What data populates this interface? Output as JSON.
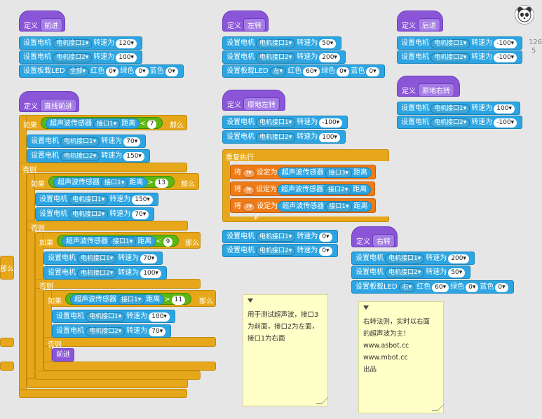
{
  "labels": {
    "define": "定义",
    "set_motor": "设置电机",
    "speed": "转速为",
    "set_led": "设置板载LED",
    "red": "红色",
    "green": "绿色",
    "blue": "蓝色",
    "if": "如果",
    "else": "否则",
    "then": "那么",
    "sensor": "超声波传感器",
    "distance": "距离",
    "repeat": "重复执行",
    "set_var": "将",
    "set_to": "设定为",
    "lt": "<",
    "gt": ">",
    "motor1": "电机接口1▾",
    "motor2": "电机接口2▾"
  },
  "scripts": {
    "forward": {
      "name": "前进",
      "m1": "120▾",
      "m2": "100▾",
      "led_pos": "全部▾",
      "r": "0▾",
      "g": "0▾",
      "b": "0▾"
    },
    "left": {
      "name": "左转",
      "m1": "50▾",
      "m2": "200▾",
      "led_pos": "左▾",
      "r": "60▾",
      "g": "0▾",
      "b": "0▾"
    },
    "back": {
      "name": "后退",
      "m1": "-100▾",
      "m2": "-100▾"
    },
    "spin_right": {
      "name": "原地右转",
      "m1": "100▾",
      "m2": "-100▾"
    },
    "spin_left": {
      "name": "原地左转",
      "m1": "-100▾",
      "m2": "100▾"
    },
    "right": {
      "name": "右转",
      "m1": "200▾",
      "m2": "50▾",
      "led_pos": "右▾",
      "r": "60▾",
      "g": "0▾",
      "b": "0▾"
    },
    "straight": {
      "name": "直线前进",
      "c1_port": "接口1▾",
      "c1_val": "7",
      "a_m1": "70▾",
      "a_m2": "150▾",
      "c2_port": "接口1▾",
      "c2_val": "13",
      "b_m1": "150▾",
      "b_m2": "70▾",
      "c3_port": "接口1▾",
      "c3_val": "9",
      "c_m1": "70▾",
      "c_m2": "100▾",
      "c4_port": "接口1▾",
      "c4_val": "11",
      "d_m1": "100▾",
      "d_m2": "70▾",
      "call": "前进"
    },
    "loop": {
      "v1": "f▾",
      "p1": "接口3▾",
      "v2": "l▾",
      "p2": "接口2▾",
      "v3": "r▾",
      "p3": "接口1▾",
      "s_m1": "0▾",
      "s_m2": "0▾"
    }
  },
  "notes": {
    "note1": [
      "用于测试超声波，接口3",
      "为前面，接口2为左面，",
      "接口1为右面"
    ],
    "note2": [
      "右转法则，实时以右面",
      "的超声波为主！",
      "www.asbot.cc",
      "www.mbot.cc",
      "出品"
    ]
  },
  "misc": {
    "partial_left": "那么",
    "counter": "126",
    "counter2": "5"
  }
}
